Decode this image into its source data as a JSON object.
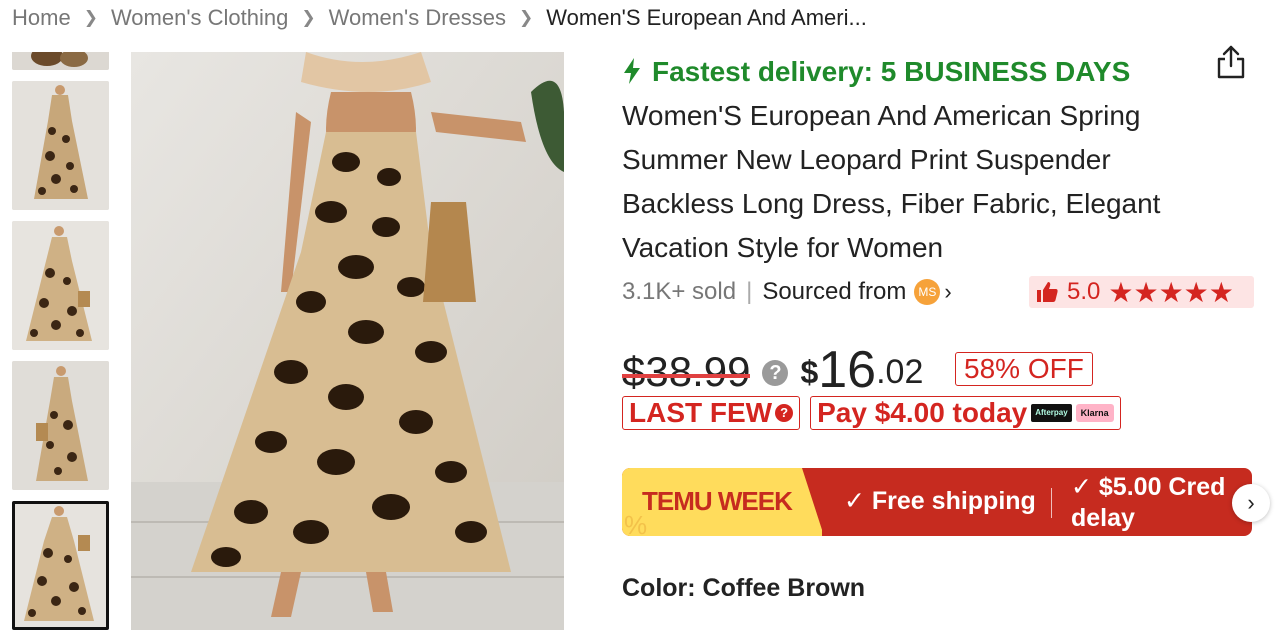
{
  "breadcrumb": {
    "items": [
      "Home",
      "Women's Clothing",
      "Women's Dresses"
    ],
    "current": "Women'S European And Ameri..."
  },
  "gallery": {
    "thumbnail_count": 5,
    "active_index": 4
  },
  "product": {
    "delivery_badge": "Fastest delivery: 5 BUSINESS DAYS",
    "title": "Women'S European And American Spring Summer New Leopard Print Suspender Backless Long Dress, Fiber Fabric, Elegant Vacation Style for Women",
    "sold": "3.1K+ sold",
    "sourced_label": "Sourced from",
    "source_badge": "MS",
    "rating": "5.0",
    "stars": "★★★★★",
    "share_icon": "share-icon"
  },
  "price": {
    "original": "$38.99",
    "currency": "$",
    "integer": "16",
    "decimal": ".02",
    "discount": "58% OFF",
    "question": "?"
  },
  "badges": {
    "last_few": "LAST FEW",
    "pay_today": "Pay $4.00 today",
    "afterpay": "Afterpay",
    "klarna": "Klarna"
  },
  "promo": {
    "brand": "TEMU WEEK",
    "free_shipping": "Free shipping",
    "credit": "$5.00 Cred",
    "credit_line2": "delay",
    "check": "✓"
  },
  "variant": {
    "color_label": "Color: Coffee Brown"
  },
  "colors": {
    "accent_red": "#d42520",
    "delivery_green": "#1f8a2b",
    "promo_yellow": "#ffdc5c",
    "promo_red": "#c62b1f"
  }
}
